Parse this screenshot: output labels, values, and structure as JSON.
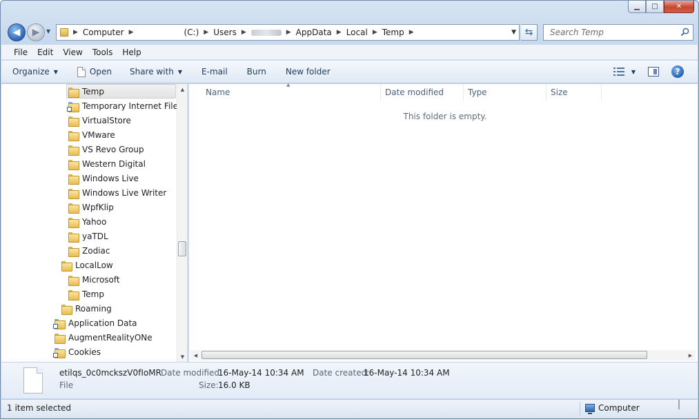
{
  "window": {
    "minimize_glyph": "▁",
    "maximize_glyph": "□",
    "close_glyph": "✕"
  },
  "address_bar": {
    "crumbs": [
      "Computer",
      "(C:)",
      "Users",
      "AppData",
      "Local",
      "Temp"
    ]
  },
  "search": {
    "placeholder": "Search Temp"
  },
  "menu": [
    "File",
    "Edit",
    "View",
    "Tools",
    "Help"
  ],
  "toolbar": {
    "organize": "Organize",
    "open": "Open",
    "share_with": "Share with",
    "email": "E-mail",
    "burn": "Burn",
    "new_folder": "New folder"
  },
  "tree": [
    {
      "label": "Temp",
      "selected": true,
      "icon": "folder-icon"
    },
    {
      "label": "Temporary Internet Files",
      "icon": "folder-link-icon"
    },
    {
      "label": "VirtualStore",
      "icon": "folder-icon"
    },
    {
      "label": "VMware",
      "icon": "folder-icon"
    },
    {
      "label": "VS Revo Group",
      "icon": "folder-icon"
    },
    {
      "label": "Western Digital",
      "icon": "folder-icon"
    },
    {
      "label": "Windows Live",
      "icon": "folder-icon"
    },
    {
      "label": "Windows Live Writer",
      "icon": "folder-icon"
    },
    {
      "label": "WpfKlip",
      "icon": "folder-icon"
    },
    {
      "label": "Yahoo",
      "icon": "folder-icon"
    },
    {
      "label": "yaTDL",
      "icon": "folder-icon"
    },
    {
      "label": "Zodiac",
      "icon": "folder-icon"
    },
    {
      "label": "LocalLow",
      "icon": "folder-icon"
    },
    {
      "label": "Microsoft",
      "icon": "folder-icon"
    },
    {
      "label": "Temp",
      "icon": "folder-icon"
    },
    {
      "label": "Roaming",
      "icon": "folder-icon"
    },
    {
      "label": "Application Data",
      "icon": "folder-link-icon"
    },
    {
      "label": "AugmentRealityONe",
      "icon": "folder-icon"
    },
    {
      "label": "Cookies",
      "icon": "folder-link-icon"
    }
  ],
  "columns": [
    "Name",
    "Date modified",
    "Type",
    "Size"
  ],
  "empty_message": "This folder is empty.",
  "details": {
    "file_name": "etilqs_0c0mckszV0fIoMR",
    "file_type": "File",
    "date_modified_label": "Date modified:",
    "date_modified": "16-May-14 10:34 AM",
    "size_label": "Size:",
    "size": "16.0 KB",
    "date_created_label": "Date created:",
    "date_created": "16-May-14 10:34 AM"
  },
  "status": {
    "selection": "1 item selected",
    "location": "Computer"
  }
}
